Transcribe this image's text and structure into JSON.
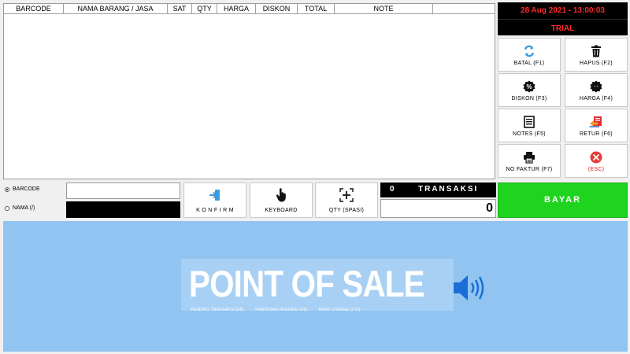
{
  "grid": {
    "columns": [
      {
        "key": "barcode",
        "label": "BARCODE",
        "width": 76
      },
      {
        "key": "nama",
        "label": "NAMA BARANG / JASA",
        "width": 132
      },
      {
        "key": "sat",
        "label": "SAT",
        "width": 31
      },
      {
        "key": "qty",
        "label": "QTY",
        "width": 32
      },
      {
        "key": "harga",
        "label": "HARGA",
        "width": 49
      },
      {
        "key": "diskon",
        "label": "DISKON",
        "width": 53
      },
      {
        "key": "total",
        "label": "TOTAL",
        "width": 47
      },
      {
        "key": "note",
        "label": "NOTE",
        "width": 125
      }
    ]
  },
  "clock": {
    "datetime": "28 Aug 2021 - 13:00:03",
    "trial_label": "TRIAL"
  },
  "function_buttons": {
    "batal": {
      "label": "BATAL (F1)",
      "icon": "refresh-icon"
    },
    "hapus": {
      "label": "HAPUS (F2)",
      "icon": "trash-icon"
    },
    "diskon": {
      "label": "DISKON (F3)",
      "icon": "discount-icon"
    },
    "harga": {
      "label": "HARGA (F4)",
      "icon": "price-icon"
    },
    "notes": {
      "label": "NOTES (F5)",
      "icon": "notes-icon"
    },
    "retur": {
      "label": "RETUR (F6)",
      "icon": "return-icon"
    },
    "nofaktur": {
      "label": "NO FAKTUR (F7)",
      "icon": "printer-icon"
    },
    "esc": {
      "label": "(ESC)",
      "icon": "close-circle-icon"
    }
  },
  "input_bar": {
    "radio_barcode": "BARCODE",
    "radio_nama": "NAMA (/)",
    "barcode_value": "",
    "konfirm_label": "K O N F I R M",
    "keyboard_label": "KEYBOARD",
    "qty_label": "QTY (SPASI)",
    "transaksi_count": "0",
    "transaksi_label": "TRANSAKSI",
    "total_value": "0",
    "bayar_label": "BAYAR"
  },
  "banner": {
    "title": "POINT OF SALE",
    "shortcuts": [
      "PENDING TRANSAKSI (F8)",
      "TAMPILKAN PENDING (F9)",
      "BANK CHARGE (F10)"
    ]
  },
  "colors": {
    "accent_green": "#1fd41f",
    "alert_red": "#ff2a2a",
    "banner_blue": "#91c4f0"
  }
}
